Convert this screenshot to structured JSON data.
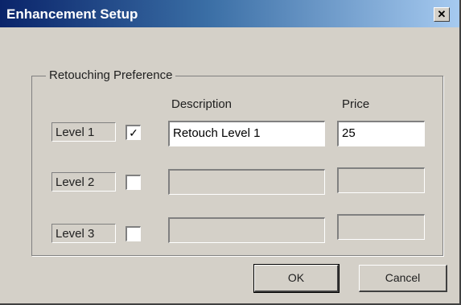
{
  "window": {
    "title": "Enhancement Setup",
    "close_glyph": "✕"
  },
  "group": {
    "label": "Retouching Preference"
  },
  "columns": {
    "description": "Description",
    "price": "Price"
  },
  "levels": [
    {
      "label": "Level 1",
      "checked": true,
      "check_glyph": "✓",
      "description": "Retouch Level 1",
      "price": "25"
    },
    {
      "label": "Level 2",
      "checked": false,
      "check_glyph": "",
      "description": "",
      "price": ""
    },
    {
      "label": "Level 3",
      "checked": false,
      "check_glyph": "",
      "description": "",
      "price": ""
    }
  ],
  "buttons": {
    "ok": "OK",
    "cancel": "Cancel"
  }
}
